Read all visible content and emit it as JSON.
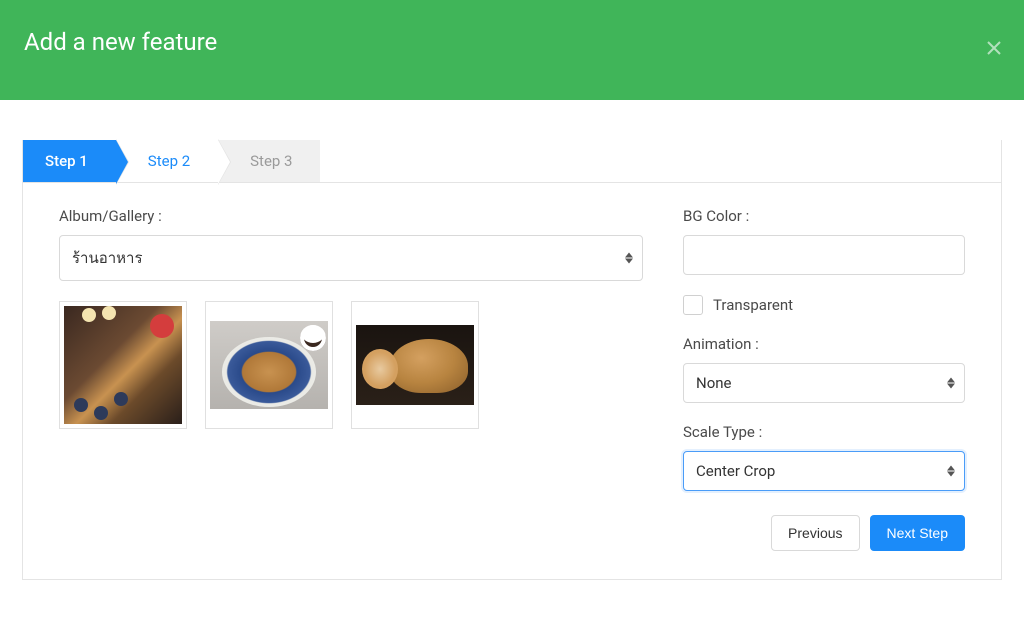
{
  "header": {
    "title": "Add a new feature"
  },
  "wizard": {
    "steps": [
      {
        "label": "Step 1",
        "state": "active"
      },
      {
        "label": "Step 2",
        "state": "completed"
      },
      {
        "label": "Step 3",
        "state": "pending"
      }
    ]
  },
  "form": {
    "album_label": "Album/Gallery :",
    "album_value": "ร้านอาหาร",
    "bg_color_label": "BG Color :",
    "bg_color_value": "",
    "transparent_label": "Transparent",
    "transparent_checked": false,
    "animation_label": "Animation :",
    "animation_value": "None",
    "scale_type_label": "Scale Type :",
    "scale_type_value": "Center Crop"
  },
  "thumbnails": [
    {
      "name": "gallery-image-1"
    },
    {
      "name": "gallery-image-2"
    },
    {
      "name": "gallery-image-3"
    }
  ],
  "buttons": {
    "previous": "Previous",
    "next": "Next Step"
  }
}
